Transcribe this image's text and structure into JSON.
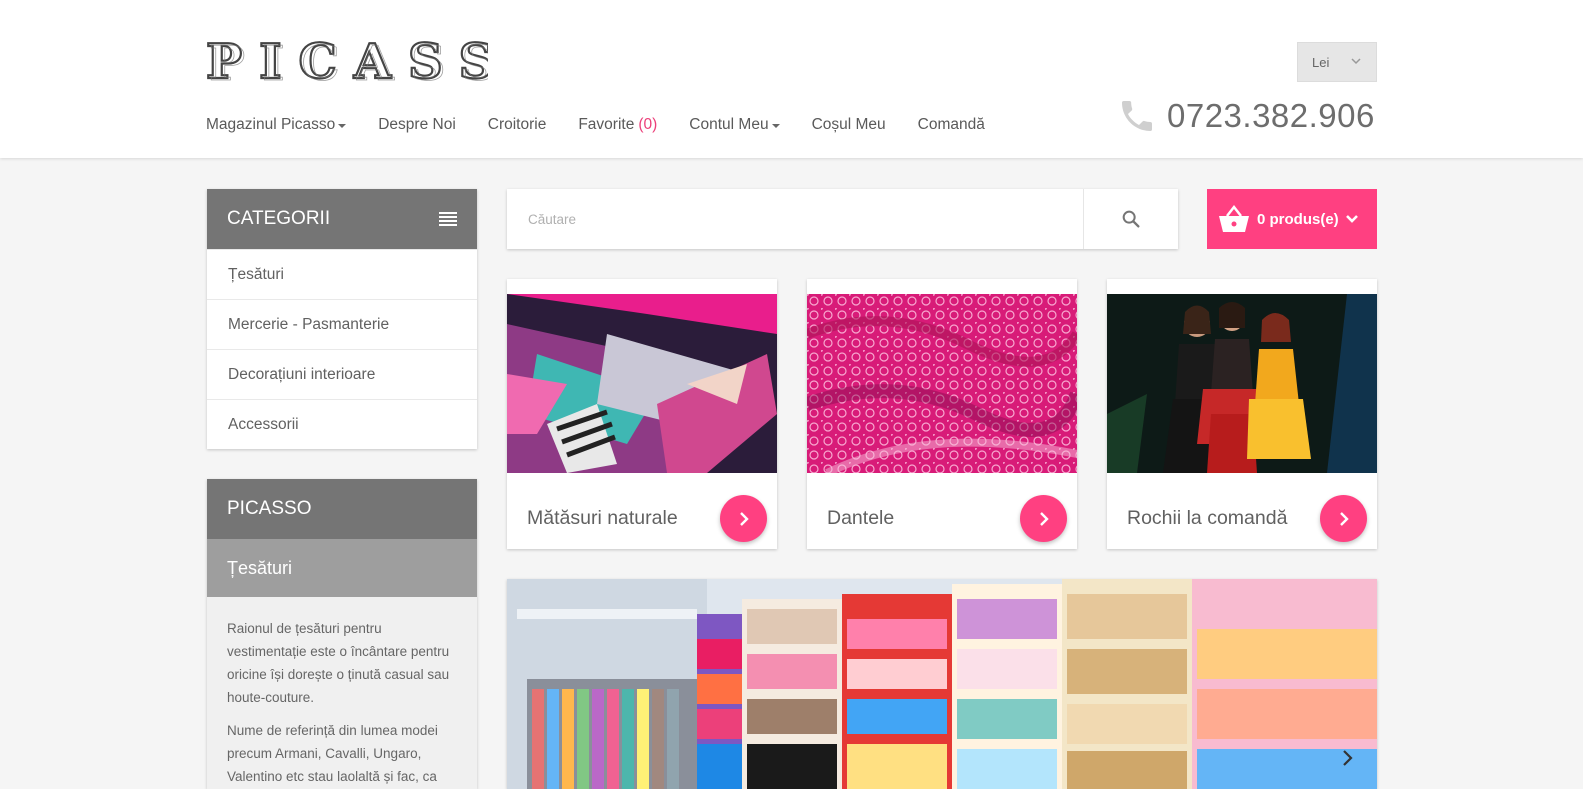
{
  "brand": {
    "logo_text": "PICASSO"
  },
  "header": {
    "currency": "Lei",
    "phone": "0723.382.906",
    "nav": [
      {
        "label": "Magazinul Picasso",
        "dropdown": true
      },
      {
        "label": "Despre Noi"
      },
      {
        "label": "Croitorie"
      },
      {
        "label": "Favorite",
        "count": "(0)"
      },
      {
        "label": "Contul Meu",
        "dropdown": true
      },
      {
        "label": "Coșul Meu"
      },
      {
        "label": "Comandă"
      }
    ]
  },
  "sidebar": {
    "categories_title": "CATEGORII",
    "categories": [
      "Țesături",
      "Mercerie - Pasmanterie",
      "Decorațiuni interioare",
      "Accessorii"
    ],
    "info_title": "PICASSO",
    "info_subtitle": "Țesături",
    "info_paragraphs": [
      "Raionul de țesături pentru vestimentație este o încântare pentru oricine își dorește o ținută casual sau houte-couture.",
      "Nume de referință din lumea modei precum Armani, Cavalli, Ungaro, Valentino etc stau laolaltă și fac, ca"
    ]
  },
  "search": {
    "placeholder": "Căutare"
  },
  "cart": {
    "label": "0 produs(e)"
  },
  "cards": [
    {
      "title": "Mătăsuri naturale",
      "image": "printed-silk-fabric"
    },
    {
      "title": "Dantele",
      "image": "pink-lace-fabric"
    },
    {
      "title": "Rochii la comandă",
      "image": "three-women-in-dresses"
    }
  ],
  "banner": {
    "image": "fabric-rolls-store"
  },
  "colors": {
    "accent": "#ff4081",
    "panel": "#757575",
    "panel_light": "#9e9e9e",
    "bg": "#f5f5f5"
  },
  "icons": [
    "chevron-down-icon",
    "phone-icon",
    "menu-list-icon",
    "search-icon",
    "basket-icon",
    "arrow-right-icon"
  ]
}
